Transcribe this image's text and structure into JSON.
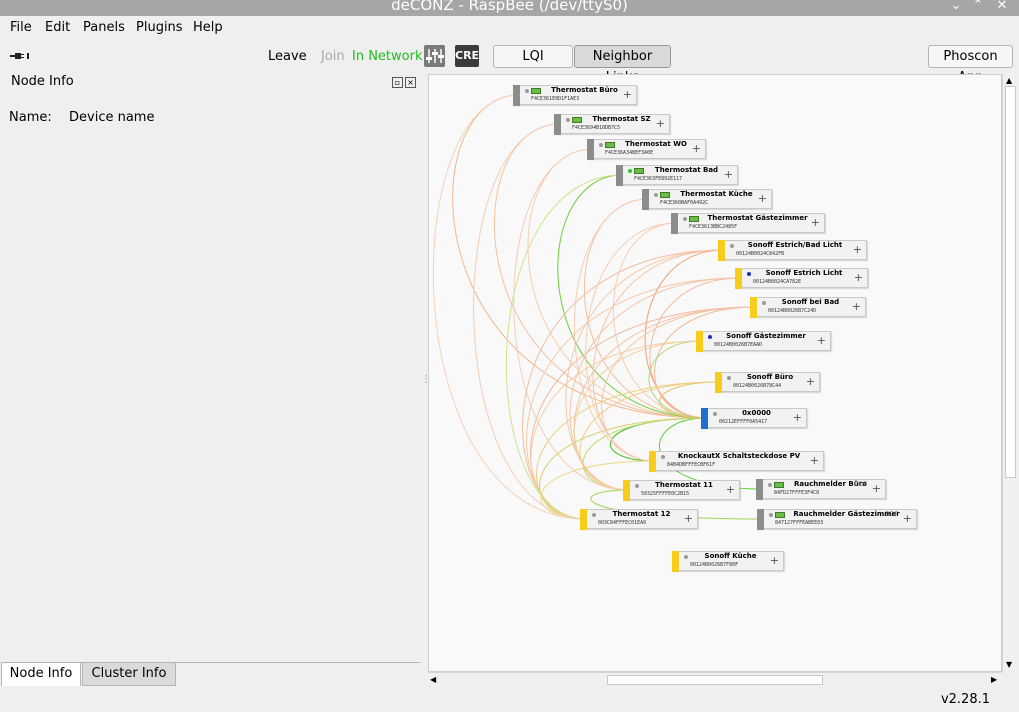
{
  "window": {
    "title": "deCONZ - RaspBee (/dev/ttyS0)",
    "buttons": [
      "⌄",
      "⌃",
      "✕"
    ]
  },
  "menu": {
    "items": [
      "File",
      "Edit",
      "Panels",
      "Plugins",
      "Help"
    ]
  },
  "toolbar": {
    "connection_icon": "plug-icon",
    "leave_label": "Leave",
    "join_label": "Join",
    "status_label": "In Network",
    "cre_label": "CRE",
    "lqi_label": "LQI",
    "neighbor_links_label": "Neighbor Links",
    "phoscon_label": "Phoscon App",
    "status_color": "#1dbf1d"
  },
  "left_panel": {
    "title": "Node Info",
    "name_label": "Name:",
    "name_value": "Device name",
    "tabs": [
      "Node Info",
      "Cluster Info"
    ]
  },
  "nodes": [
    {
      "name": "Thermostat Büro",
      "addr": "F4CE361E0D1F1AE3",
      "type": "thermostat",
      "bar": "#8c8c8c",
      "dot": "#9a9a9a"
    },
    {
      "name": "Thermostat SZ",
      "addr": "F4CE3694B10DB7C5",
      "type": "thermostat",
      "bar": "#8c8c8c",
      "dot": "#9a9a9a"
    },
    {
      "name": "Thermostat WO",
      "addr": "F4CE36A34BEF3A0E",
      "type": "thermostat",
      "bar": "#8c8c8c",
      "dot": "#9a9a9a"
    },
    {
      "name": "Thermostat Bad",
      "addr": "F4CE363FE892E117",
      "type": "thermostat",
      "bar": "#8c8c8c",
      "dot": "#1fcf1f"
    },
    {
      "name": "Thermostat Küche",
      "addr": "F4CE360BAF0A492C",
      "type": "thermostat",
      "bar": "#8c8c8c",
      "dot": "#9a9a9a"
    },
    {
      "name": "Thermostat Gästezimmer",
      "addr": "F4CE3613BBC2485F",
      "type": "thermostat",
      "bar": "#8c8c8c",
      "dot": "#9a9a9a"
    },
    {
      "name": "Sonoff Estrich/Bad Licht",
      "addr": "00124B0024C842FB",
      "type": "router",
      "bar": "#f7cd1b",
      "dot": "#9a9a9a"
    },
    {
      "name": "Sonoff Estrich Licht",
      "addr": "00124B0024CA782E",
      "type": "router",
      "bar": "#f7cd1b",
      "dot": "#1a2fbf"
    },
    {
      "name": "Sonoff bei Bad",
      "addr": "00124B0026B7C24D",
      "type": "router",
      "bar": "#f7cd1b",
      "dot": "#9a9a9a"
    },
    {
      "name": "Sonoff Gästezimmer",
      "addr": "00124B0026B7EAAD",
      "type": "router",
      "bar": "#f7cd1b",
      "dot": "#1a2fbf"
    },
    {
      "name": "Sonoff Büro",
      "addr": "00124B0026B78C44",
      "type": "router",
      "bar": "#f7cd1b",
      "dot": "#9a9a9a"
    },
    {
      "name": "0x0000",
      "addr": "00212EFFFF0A5417",
      "type": "coordinator",
      "bar": "#1e6fd0",
      "dot": "#9a9a9a"
    },
    {
      "name": "KnockautX Schaltsteckdose PV",
      "addr": "84B4DBFFFECBF61F",
      "type": "router",
      "bar": "#f7cd1b",
      "dot": "#9a9a9a"
    },
    {
      "name": "Thermostat 11",
      "addr": "50325FFFFE0C2B15",
      "type": "router",
      "bar": "#f7cd1b",
      "dot": "#9a9a9a"
    },
    {
      "name": "Rauchmelder Büro",
      "addr": "84FD27FFFE3F4C0",
      "type": "sensor",
      "bar": "#8c8c8c",
      "dot": "#9a9a9a",
      "ddf": "DDF"
    },
    {
      "name": "Thermostat 12",
      "addr": "003C84FFFEC01EA0",
      "type": "router",
      "bar": "#f7cd1b",
      "dot": "#9a9a9a"
    },
    {
      "name": "Rauchmelder Gästezimmer",
      "addr": "847127FFFEABEE03",
      "type": "sensor",
      "bar": "#8c8c8c",
      "dot": "#9a9a9a",
      "ddf": "DDF"
    },
    {
      "name": "Sonoff Küche",
      "addr": "00124B0026B7F80F",
      "type": "router",
      "bar": "#f7cd1b",
      "dot": "#9a9a9a"
    }
  ],
  "status": {
    "version": "v2.28.1"
  }
}
